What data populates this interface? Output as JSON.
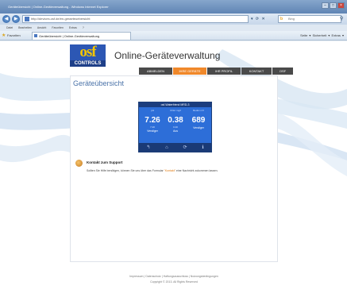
{
  "browser": {
    "window_title": "Geräteübersicht | Online-Geräteverwaltung - Windows Internet Explorer",
    "url": "http://devices.osf.de/en-geraeteuebersicht",
    "search_placeholder": "Bing",
    "menu": [
      "Datei",
      "Bearbeiten",
      "Ansicht",
      "Favoriten",
      "Extras",
      "?"
    ],
    "favorites_label": "Favoriten",
    "tab_title": "Geräteübersicht | Online-Geräteverwaltung",
    "command_bar": "Seite ▾  Sicherheit ▾  Extras ▾"
  },
  "site": {
    "logo_text": "osf",
    "logo_sub": "CONTROLS",
    "title": "Online-Geräteverwaltung",
    "nav": [
      {
        "label": "ABMELDEN",
        "active": false
      },
      {
        "label": "IHRE GERÄTE",
        "active": true
      },
      {
        "label": "IHR PROFIL",
        "active": false
      },
      {
        "label": "KONTAKT",
        "active": false
      },
      {
        "label": "OSF",
        "active": false
      }
    ]
  },
  "main": {
    "section_title": "Geräteübersicht",
    "device": {
      "name": "osf-Waterfriend MRD-3",
      "columns": [
        {
          "label": "pH",
          "value": "7.26",
          "sub": "7.20",
          "state": "Verstiger"
        },
        {
          "label": "Chlor mg/l",
          "value": "0.38",
          "sub": "0.40",
          "state": "Aus"
        },
        {
          "label": "Redox mV",
          "value": "689",
          "sub": "",
          "state": "Verstiger"
        }
      ]
    },
    "support": {
      "title": "Kontakt zum Support",
      "text_before": "Sollten Sie Hilfe benötigen, können Sie uns über das Formular ",
      "link": "\"Kontakt\"",
      "text_after": " eine Nachricht zukommen lassen."
    }
  },
  "footer": {
    "links": "Impressum | Datenschutz | Haftungsausschluss | Nutzungsbedingungen",
    "copyright": "Copyright © 2013. All Rights Reserved"
  }
}
